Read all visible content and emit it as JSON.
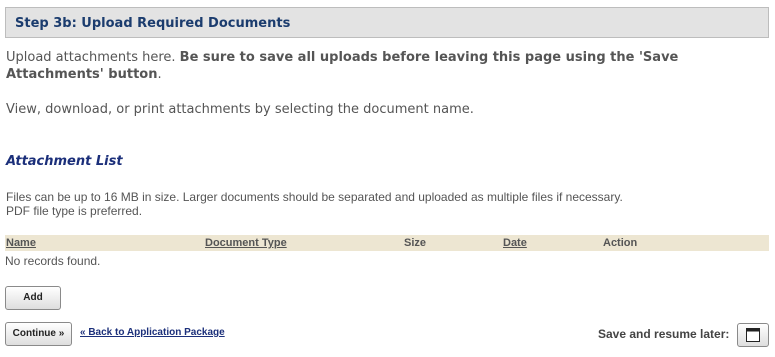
{
  "step": {
    "title": "Step 3b: Upload Required Documents"
  },
  "intro": {
    "plain": "Upload attachments here. ",
    "bold": "Be sure to save all uploads before leaving this page using the 'Save Attachments' button",
    "end": ".",
    "line2": "View, download, or print attachments by selecting the document name."
  },
  "attachments": {
    "title": "Attachment List",
    "info_line1": "Files can be up to 16 MB in size. Larger documents should be separated and uploaded as multiple files if necessary.",
    "info_line2": "PDF file type is preferred.",
    "columns": {
      "name": "Name",
      "document_type": "Document Type",
      "size": "Size",
      "date": "Date",
      "action": "Action"
    },
    "empty_message": "No records found.",
    "add_label": "Add"
  },
  "footer": {
    "continue_label": "Continue »",
    "back_label": "« Back to Application Package",
    "save_resume_label": "Save and resume later:",
    "save_icon": "save-window-icon"
  }
}
